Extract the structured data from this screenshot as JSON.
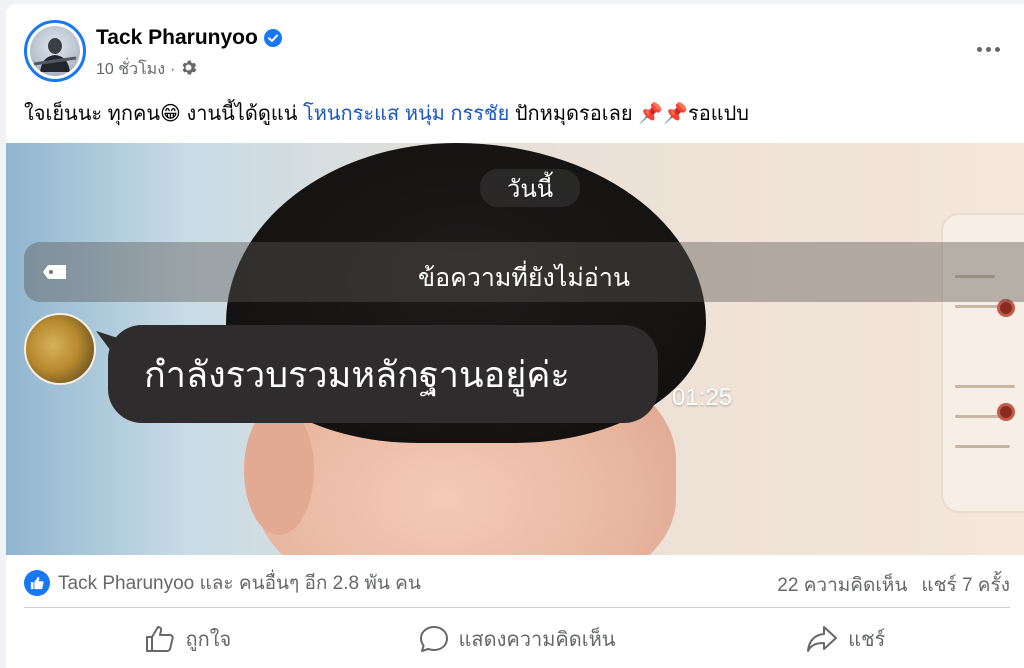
{
  "post": {
    "author": "Tack Pharunyoo",
    "timestamp": "10 ชั่วโมง",
    "meta_separator": "·",
    "caption": {
      "part1": "ใจเย็นนะ ทุกคน",
      "emoji_grin": "😁",
      "part2": " งานนี้ได้ดูแน่ ",
      "tag1": "โหนกระแส",
      "tag2": "หนุ่ม กรรชัย",
      "part3": " ปักหมุดรอเลย ",
      "emoji_pin": "📌📌",
      "part4": "รอแปบ"
    }
  },
  "media": {
    "date_label": "วันนี้",
    "unread_label": "ข้อความที่ยังไม่อ่าน",
    "message": "กำลังรวบรวมหลักฐานอยู่ค่ะ",
    "message_time": "01:25"
  },
  "reactions": {
    "summary": "Tack Pharunyoo และ คนอื่นๆ อีก 2.8 พัน คน",
    "comments": "22 ความคิดเห็น",
    "shares": "แชร์ 7 ครั้ง"
  },
  "actions": {
    "like": "ถูกใจ",
    "comment": "แสดงความคิดเห็น",
    "share": "แชร์"
  },
  "colors": {
    "accent": "#1877f2",
    "tag_link": "#1a56c9",
    "secondary_text": "#65676b"
  },
  "icons": [
    "verified-badge-icon",
    "settings-gear-icon",
    "more-options-icon",
    "label-tag-icon",
    "like-badge-icon",
    "thumbs-up-icon",
    "comment-bubble-icon",
    "share-arrow-icon"
  ]
}
